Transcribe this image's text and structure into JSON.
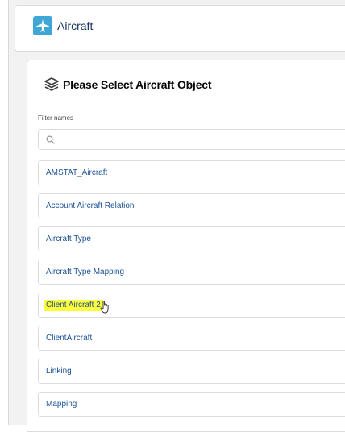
{
  "header": {
    "app_icon": "plane-icon",
    "title": "Aircraft"
  },
  "card": {
    "header_icon": "layers-icon",
    "title": "Please Select Aircraft Object",
    "filter": {
      "label": "Filter names",
      "placeholder": "",
      "value": "",
      "icon": "search-icon"
    },
    "items": [
      {
        "label": "AMSTAT_Aircraft",
        "highlighted": false
      },
      {
        "label": "Account Aircraft Relation",
        "highlighted": false
      },
      {
        "label": "Aircraft Type",
        "highlighted": false
      },
      {
        "label": "Aircraft Type Mapping",
        "highlighted": false
      },
      {
        "label": "Client Aircraft 2",
        "highlighted": true
      },
      {
        "label": "ClientAircraft",
        "highlighted": false
      },
      {
        "label": "Linking",
        "highlighted": false
      },
      {
        "label": "Mapping",
        "highlighted": false
      }
    ]
  },
  "colors": {
    "accent": "#3fa7d6",
    "link": "#1b5297",
    "highlight": "#fdff3d"
  }
}
